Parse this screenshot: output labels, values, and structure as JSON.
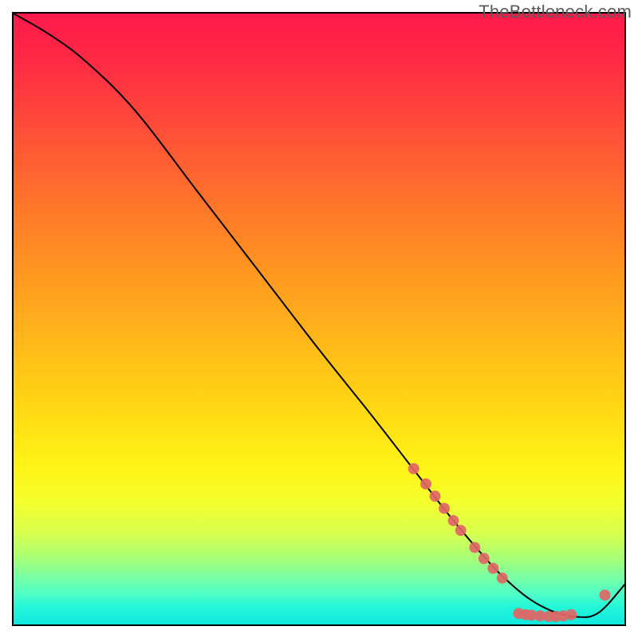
{
  "watermark": "TheBottleneck.com",
  "chart_data": {
    "type": "line",
    "title": "",
    "xlabel": "",
    "ylabel": "",
    "xlim": [
      0,
      100
    ],
    "ylim": [
      0,
      100
    ],
    "grid": false,
    "legend": false,
    "series": [
      {
        "name": "curve",
        "x": [
          0,
          6,
          12,
          20,
          30,
          40,
          50,
          58,
          65,
          72,
          78,
          81,
          84,
          87,
          90,
          93,
          95,
          97,
          100
        ],
        "y": [
          100,
          96.5,
          92,
          84,
          71,
          58,
          45,
          35,
          26,
          17,
          10,
          7,
          4.5,
          2.7,
          1.6,
          1.2,
          1.5,
          3.0,
          6.5
        ]
      }
    ],
    "markers": [
      {
        "x": 65.5,
        "y": 25.5
      },
      {
        "x": 67.5,
        "y": 23.0
      },
      {
        "x": 69.0,
        "y": 21.0
      },
      {
        "x": 70.5,
        "y": 19.0
      },
      {
        "x": 72.0,
        "y": 17.0
      },
      {
        "x": 73.2,
        "y": 15.4
      },
      {
        "x": 75.5,
        "y": 12.6
      },
      {
        "x": 77.0,
        "y": 10.8
      },
      {
        "x": 78.5,
        "y": 9.2
      },
      {
        "x": 80.0,
        "y": 7.6
      },
      {
        "x": 82.7,
        "y": 1.8
      },
      {
        "x": 83.8,
        "y": 1.6
      },
      {
        "x": 84.8,
        "y": 1.5
      },
      {
        "x": 86.2,
        "y": 1.4
      },
      {
        "x": 87.6,
        "y": 1.3
      },
      {
        "x": 88.8,
        "y": 1.3
      },
      {
        "x": 90.0,
        "y": 1.4
      },
      {
        "x": 91.3,
        "y": 1.6
      },
      {
        "x": 96.8,
        "y": 4.8
      }
    ]
  }
}
